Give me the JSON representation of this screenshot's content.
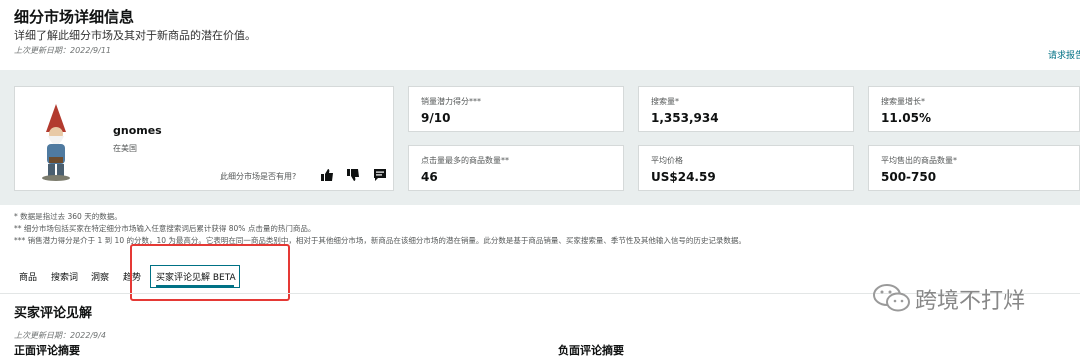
{
  "header": {
    "title": "细分市场详细信息",
    "subtitle": "详细了解此细分市场及其对于新商品的潜在价值。",
    "updated": "上次更新日期：2022/9/11",
    "request_link": "请求报告"
  },
  "product": {
    "name": "gnomes",
    "region": "在美国",
    "helpful_question": "此细分市场是否有用?"
  },
  "metrics": [
    {
      "label": "销量潜力得分***",
      "value": "9/10"
    },
    {
      "label": "搜索量*",
      "value": "1,353,934"
    },
    {
      "label": "搜索量增长*",
      "value": "11.05%"
    },
    {
      "label": "点击量最多的商品数量**",
      "value": "46"
    },
    {
      "label": "平均价格",
      "value": "US$24.59"
    },
    {
      "label": "平均售出的商品数量*",
      "value": "500-750"
    }
  ],
  "notes": [
    "* 数据是指过去 360 天的数据。",
    "** 细分市场包括买家在特定细分市场输入任意搜索词后累计获得 80% 点击量的热门商品。",
    "*** 销售潜力得分是介于 1 到 10 的分数，10 为最高分。它表明在同一商品类别中，相对于其他细分市场，新商品在该细分市场的潜在销量。此分数是基于商品销量、买家搜索量、季节性及其他输入信号的历史记录数据。"
  ],
  "tabs": [
    "商品",
    "搜索词",
    "洞察",
    "趋势",
    "买家评论见解 BETA"
  ],
  "section": {
    "title": "买家评论见解",
    "updated": "上次更新日期：2022/9/4",
    "left_heading": "正面评论摘要",
    "right_heading": "负面评论摘要"
  },
  "watermark": {
    "text": "跨境不打烊",
    "icon": "wechat-icon"
  },
  "colors": {
    "accent": "#007185",
    "highlight": "#e53935",
    "band": "#e9eeee"
  }
}
